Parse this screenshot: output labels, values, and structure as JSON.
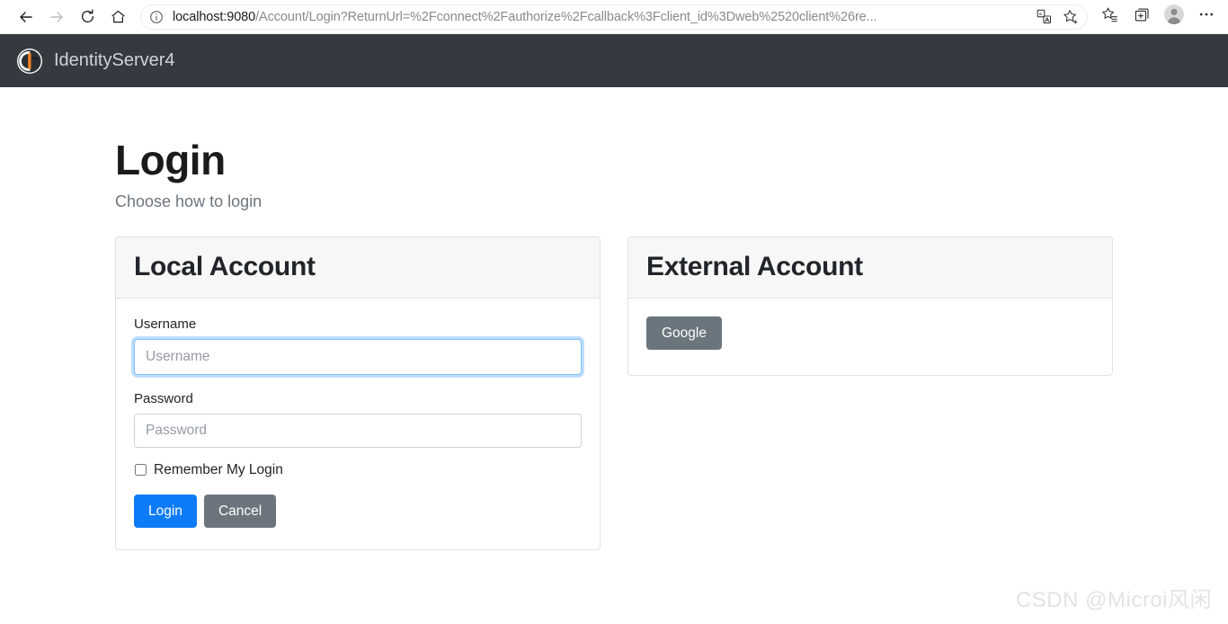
{
  "browser": {
    "back_label": "Back",
    "forward_label": "Forward",
    "refresh_label": "Refresh",
    "home_label": "Home",
    "site_info_label": "View site information",
    "url_host": "localhost:9080",
    "url_path": "/Account/Login?ReturnUrl=%2Fconnect%2Fauthorize%2Fcallback%3Fclient_id%3Dweb%2520client%26re...",
    "translate_label": "Translate this page",
    "favorite_label": "Add this page to favorites",
    "favorites_label": "Favorites",
    "collections_label": "Collections",
    "profile_label": "Profile",
    "settings_label": "Settings and more"
  },
  "navbar": {
    "brand": "IdentityServer4",
    "brand_color": "#cfd3d7",
    "background_color": "#343a40",
    "logo_icon": "identityserver-logo-icon",
    "logo_accent_color": "#f58320"
  },
  "page": {
    "title": "Login",
    "subtitle": "Choose how to login"
  },
  "local_account": {
    "header": "Local Account",
    "username_label": "Username",
    "username_placeholder": "Username",
    "username_value": "",
    "password_label": "Password",
    "password_placeholder": "Password",
    "password_value": "",
    "remember_label": "Remember My Login",
    "remember_checked": false,
    "login_button": "Login",
    "cancel_button": "Cancel",
    "login_button_color": "#0d7bf7",
    "cancel_button_color": "#6c757d"
  },
  "external_account": {
    "header": "External Account",
    "providers": [
      {
        "label": "Google",
        "color": "#6a757d"
      }
    ]
  },
  "watermark": {
    "text": "CSDN @Microi风闲"
  }
}
